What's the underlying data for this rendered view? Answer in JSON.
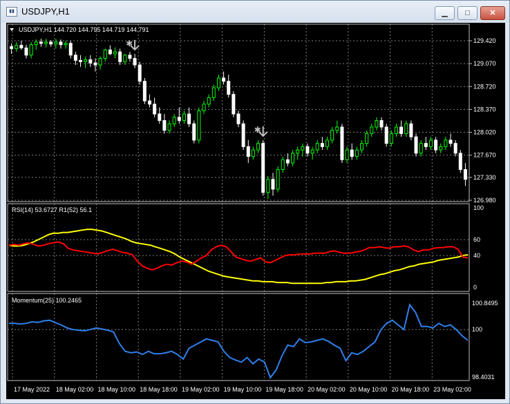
{
  "window": {
    "title": "USDJPY,H1",
    "minimize_symbol": "▁",
    "maximize_symbol": "□",
    "close_symbol": "✕"
  },
  "main_panel": {
    "header": "USDJPY,H1  144.720 144.795 144.719 144.791",
    "price_axis_ticks": [
      "129.420",
      "129.070",
      "128.720",
      "128.370",
      "128.020",
      "127.670",
      "127.330",
      "126.980"
    ]
  },
  "rsi_panel": {
    "header": "RSI(14) 53.6727  R1(52) 56.1",
    "axis_ticks": [
      "100",
      "60",
      "40",
      "0"
    ]
  },
  "momentum_panel": {
    "header": "Momentum(25) 100.2465",
    "axis_ticks": [
      "100.8495",
      "100",
      "98.4031"
    ]
  },
  "time_axis": [
    "17 May 2022",
    "18 May 02:00",
    "18 May 10:00",
    "18 May 18:00",
    "19 May 02:00",
    "19 May 10:00",
    "19 May 18:00",
    "20 May 02:00",
    "20 May 10:00",
    "20 May 18:00",
    "23 May 02:00"
  ],
  "colors": {
    "background": "#000000",
    "bull_candle": "#00ff00",
    "bear_candle": "#ffffff",
    "rsi_fast": "#ff0000",
    "rsi_slow": "#ffff00",
    "momentum": "#2f80ed",
    "arrow": "#c0c0c0"
  },
  "chart_data": [
    {
      "type": "candlestick",
      "title": "USDJPY,H1",
      "ylim": [
        126.98,
        129.42
      ],
      "ohlc": [
        [
          129.33,
          129.38,
          129.22,
          129.3
        ],
        [
          129.3,
          129.4,
          129.25,
          129.35
        ],
        [
          129.35,
          129.42,
          129.28,
          129.31
        ],
        [
          129.31,
          129.36,
          129.15,
          129.2
        ],
        [
          129.2,
          129.4,
          129.15,
          129.36
        ],
        [
          129.36,
          129.44,
          129.28,
          129.4
        ],
        [
          129.4,
          129.45,
          129.33,
          129.38
        ],
        [
          129.38,
          129.45,
          129.32,
          129.4
        ],
        [
          129.4,
          129.43,
          129.33,
          129.37
        ],
        [
          129.37,
          129.45,
          129.3,
          129.4
        ],
        [
          129.4,
          129.44,
          129.3,
          129.36
        ],
        [
          129.36,
          129.42,
          129.3,
          129.38
        ],
        [
          129.38,
          129.42,
          129.15,
          129.2
        ],
        [
          129.2,
          129.25,
          129.05,
          129.12
        ],
        [
          129.12,
          129.2,
          129.02,
          129.1
        ],
        [
          129.1,
          129.18,
          129.0,
          129.13
        ],
        [
          129.13,
          129.2,
          129.02,
          129.08
        ],
        [
          129.08,
          129.15,
          128.95,
          129.05
        ],
        [
          129.05,
          129.18,
          128.98,
          129.15
        ],
        [
          129.15,
          129.3,
          129.1,
          129.28
        ],
        [
          129.28,
          129.35,
          129.2,
          129.22
        ],
        [
          129.22,
          129.32,
          129.15,
          129.25
        ],
        [
          129.25,
          129.3,
          129.05,
          129.1
        ],
        [
          129.1,
          129.22,
          129.05,
          129.2
        ],
        [
          129.2,
          129.25,
          129.1,
          129.15
        ],
        [
          129.15,
          129.22,
          129.0,
          129.05
        ],
        [
          129.05,
          129.1,
          128.75,
          128.8
        ],
        [
          128.8,
          128.85,
          128.45,
          128.5
        ],
        [
          128.5,
          128.6,
          128.4,
          128.45
        ],
        [
          128.45,
          128.55,
          128.25,
          128.3
        ],
        [
          128.3,
          128.4,
          128.15,
          128.2
        ],
        [
          128.2,
          128.3,
          128.0,
          128.05
        ],
        [
          128.05,
          128.2,
          128.0,
          128.15
        ],
        [
          128.15,
          128.3,
          128.1,
          128.25
        ],
        [
          128.25,
          128.4,
          128.15,
          128.2
        ],
        [
          128.2,
          128.35,
          128.15,
          128.3
        ],
        [
          128.3,
          128.4,
          128.1,
          128.15
        ],
        [
          128.15,
          128.2,
          127.85,
          127.9
        ],
        [
          127.9,
          128.4,
          127.85,
          128.35
        ],
        [
          128.35,
          128.5,
          128.3,
          128.45
        ],
        [
          128.45,
          128.6,
          128.4,
          128.55
        ],
        [
          128.55,
          128.75,
          128.5,
          128.7
        ],
        [
          128.7,
          128.9,
          128.65,
          128.85
        ],
        [
          128.85,
          128.95,
          128.75,
          128.8
        ],
        [
          128.8,
          128.9,
          128.55,
          128.6
        ],
        [
          128.6,
          128.65,
          128.25,
          128.3
        ],
        [
          128.3,
          128.35,
          128.1,
          128.15
        ],
        [
          128.15,
          128.2,
          127.75,
          127.8
        ],
        [
          127.8,
          127.9,
          127.55,
          127.65
        ],
        [
          127.65,
          127.8,
          127.6,
          127.75
        ],
        [
          127.75,
          127.9,
          127.7,
          127.85
        ],
        [
          127.85,
          127.9,
          127.05,
          127.1
        ],
        [
          127.1,
          127.35,
          127.0,
          127.3
        ],
        [
          127.3,
          127.4,
          127.05,
          127.15
        ],
        [
          127.15,
          127.5,
          127.1,
          127.45
        ],
        [
          127.45,
          127.65,
          127.4,
          127.6
        ],
        [
          127.6,
          127.7,
          127.5,
          127.55
        ],
        [
          127.55,
          127.75,
          127.5,
          127.7
        ],
        [
          127.7,
          127.8,
          127.6,
          127.75
        ],
        [
          127.75,
          127.85,
          127.65,
          127.8
        ],
        [
          127.8,
          127.85,
          127.65,
          127.7
        ],
        [
          127.7,
          127.8,
          127.6,
          127.75
        ],
        [
          127.75,
          127.9,
          127.7,
          127.85
        ],
        [
          127.85,
          127.95,
          127.75,
          127.8
        ],
        [
          127.8,
          127.95,
          127.75,
          127.9
        ],
        [
          127.9,
          128.1,
          127.85,
          128.05
        ],
        [
          128.05,
          128.2,
          128.0,
          128.1
        ],
        [
          128.1,
          128.15,
          127.55,
          127.6
        ],
        [
          127.6,
          127.8,
          127.55,
          127.75
        ],
        [
          127.75,
          127.85,
          127.6,
          127.65
        ],
        [
          127.65,
          127.8,
          127.6,
          127.75
        ],
        [
          127.75,
          127.9,
          127.7,
          127.85
        ],
        [
          127.85,
          128.05,
          127.8,
          128.0
        ],
        [
          128.0,
          128.15,
          127.95,
          128.1
        ],
        [
          128.1,
          128.25,
          128.05,
          128.2
        ],
        [
          128.2,
          128.25,
          128.05,
          128.1
        ],
        [
          128.1,
          128.15,
          127.8,
          127.85
        ],
        [
          127.85,
          128.05,
          127.8,
          128.0
        ],
        [
          128.0,
          128.15,
          127.95,
          128.1
        ],
        [
          128.1,
          128.2,
          127.95,
          128.0
        ],
        [
          128.0,
          128.2,
          127.95,
          128.15
        ],
        [
          128.15,
          128.2,
          127.9,
          127.95
        ],
        [
          127.95,
          128.0,
          127.65,
          127.7
        ],
        [
          127.7,
          127.9,
          127.65,
          127.85
        ],
        [
          127.85,
          127.95,
          127.75,
          127.8
        ],
        [
          127.8,
          127.95,
          127.75,
          127.9
        ],
        [
          127.9,
          127.95,
          127.7,
          127.75
        ],
        [
          127.75,
          127.85,
          127.7,
          127.8
        ],
        [
          127.8,
          127.95,
          127.75,
          127.9
        ],
        [
          127.9,
          128.0,
          127.8,
          127.85
        ],
        [
          127.85,
          127.9,
          127.65,
          127.7
        ],
        [
          127.7,
          127.75,
          127.4,
          127.45
        ],
        [
          127.45,
          127.55,
          127.2,
          127.3
        ]
      ],
      "signal_arrows": [
        25,
        51
      ]
    },
    {
      "type": "line",
      "title": "RSI(14) 53.6727  R1(52) 56.1",
      "ylim": [
        0,
        100
      ],
      "series": [
        {
          "name": "RSI(14)",
          "color": "#ff0000",
          "values": [
            53,
            54,
            53,
            55,
            56,
            54,
            52,
            53,
            55,
            56,
            57,
            55,
            49,
            47,
            46,
            45,
            44,
            43,
            42,
            44,
            46,
            48,
            46,
            44,
            43,
            41,
            33,
            27,
            24,
            22,
            24,
            27,
            29,
            28,
            31,
            33,
            32,
            29,
            33,
            37,
            40,
            47,
            51,
            53,
            51,
            45,
            38,
            36,
            34,
            33,
            35,
            37,
            32,
            31,
            34,
            37,
            40,
            41,
            41,
            42,
            42,
            42,
            43,
            43,
            43,
            45,
            46,
            44,
            43,
            43,
            44,
            45,
            47,
            50,
            50,
            51,
            50,
            49,
            51,
            51,
            52,
            51,
            47,
            45,
            47,
            47,
            49,
            50,
            50,
            51,
            51,
            48,
            38,
            37
          ]
        },
        {
          "name": "R1(52)",
          "color": "#ffff00",
          "values": [
            53,
            52,
            52,
            53,
            55,
            57,
            60,
            63,
            66,
            68,
            68,
            69,
            69,
            70,
            71,
            72,
            73,
            73,
            72,
            71,
            69,
            67,
            65,
            63,
            61,
            58,
            56,
            55,
            54,
            53,
            51,
            49,
            47,
            45,
            42,
            38,
            35,
            32,
            29,
            26,
            23,
            20,
            18,
            16,
            14,
            13,
            12,
            11,
            10,
            9,
            8,
            8,
            7,
            7,
            7,
            6,
            6,
            6,
            5,
            5,
            5,
            5,
            5,
            5,
            5,
            6,
            6,
            7,
            7,
            7,
            8,
            8,
            9,
            10,
            12,
            14,
            16,
            17,
            19,
            21,
            22,
            24,
            26,
            27,
            29,
            30,
            31,
            32,
            34,
            35,
            36,
            37,
            38,
            40,
            41
          ]
        }
      ]
    },
    {
      "type": "line",
      "title": "Momentum(25) 100.2465",
      "ylim": [
        98.4031,
        100.8495
      ],
      "series": [
        {
          "name": "Momentum(25)",
          "color": "#2f80ed",
          "values": [
            100.2,
            100.2,
            100.18,
            100.2,
            100.25,
            100.23,
            100.28,
            100.3,
            100.22,
            100.15,
            100.05,
            100.0,
            99.98,
            99.96,
            100.0,
            100.05,
            100.02,
            99.98,
            99.92,
            99.55,
            99.3,
            99.25,
            99.28,
            99.2,
            99.3,
            99.22,
            99.22,
            99.25,
            99.3,
            99.2,
            99.05,
            99.4,
            99.5,
            99.6,
            99.7,
            99.65,
            99.6,
            99.3,
            99.1,
            99.02,
            98.95,
            99.1,
            98.9,
            99.05,
            98.95,
            98.45,
            98.7,
            99.15,
            99.5,
            99.45,
            99.7,
            99.58,
            99.6,
            99.65,
            99.7,
            99.62,
            99.5,
            99.4,
            99.0,
            99.25,
            99.2,
            99.3,
            99.45,
            99.6,
            99.98,
            100.2,
            100.3,
            100.15,
            100.0,
            100.8,
            100.55,
            100.1,
            100.1,
            100.05,
            100.2,
            100.1,
            100.15,
            100.0,
            99.8,
            99.65
          ]
        }
      ]
    }
  ]
}
